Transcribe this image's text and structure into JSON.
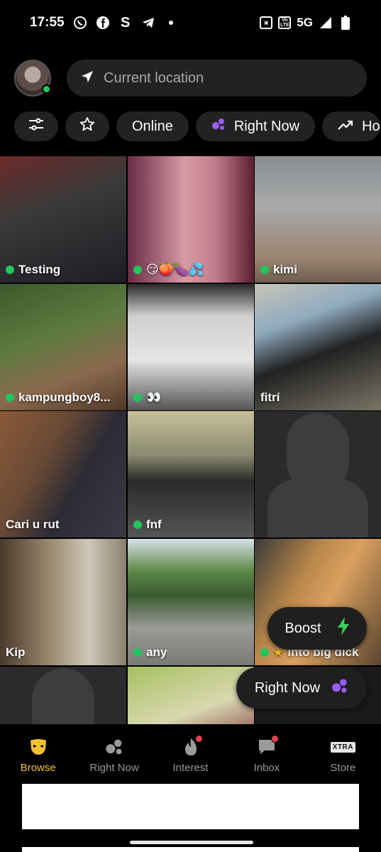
{
  "status_bar": {
    "time": "17:55",
    "network": "5G",
    "volte": "Vo LTE",
    "icons": [
      "whatsapp-icon",
      "facebook-icon",
      "s-icon",
      "telegram-icon",
      "dot-icon",
      "nfc-icon",
      "volte-icon",
      "signal-icon",
      "battery-icon"
    ]
  },
  "header": {
    "location_placeholder": "Current location",
    "location_icon": "navigation-arrow-icon"
  },
  "filters": {
    "items": [
      {
        "label": "",
        "icon": "sliders-icon"
      },
      {
        "label": "",
        "icon": "star-icon"
      },
      {
        "label": "Online",
        "icon": ""
      },
      {
        "label": "Right Now",
        "icon": "right-now-icon"
      },
      {
        "label": "Ho",
        "icon": "trending-icon"
      }
    ]
  },
  "grid": {
    "tiles": [
      {
        "name": "Testing",
        "online": true
      },
      {
        "name": "😏🍑🍆💦",
        "online": true
      },
      {
        "name": "kimi",
        "online": true
      },
      {
        "name": "kampungboy8...",
        "online": true
      },
      {
        "name": "👀",
        "online": true
      },
      {
        "name": "fitrí",
        "online": false
      },
      {
        "name": "Cari u rut",
        "online": false
      },
      {
        "name": "fnf",
        "online": true
      },
      {
        "name": "",
        "online": false,
        "placeholder": true
      },
      {
        "name": "Kip",
        "online": false
      },
      {
        "name": "any",
        "online": true
      },
      {
        "name": "Into big dick",
        "online": true,
        "favorite": true
      },
      {
        "name": "",
        "online": false,
        "placeholder": true
      },
      {
        "name": "",
        "online": false
      },
      {
        "name": "",
        "online": false
      }
    ]
  },
  "floating": {
    "boost_label": "Boost",
    "right_now_label": "Right Now"
  },
  "bottom_nav": {
    "items": [
      {
        "label": "Browse",
        "active": true,
        "badge": false
      },
      {
        "label": "Right Now",
        "active": false,
        "badge": false
      },
      {
        "label": "Interest",
        "active": false,
        "badge": true
      },
      {
        "label": "Inbox",
        "active": false,
        "badge": true
      },
      {
        "label": "Store",
        "active": false,
        "badge": false
      }
    ],
    "xtra_badge": "XTRA"
  },
  "colors": {
    "online": "#22c55e",
    "active_nav": "#f2c230",
    "right_now_purple": "#9b5cf6",
    "boost_green": "#3ad15b",
    "notification": "#e8414b"
  }
}
